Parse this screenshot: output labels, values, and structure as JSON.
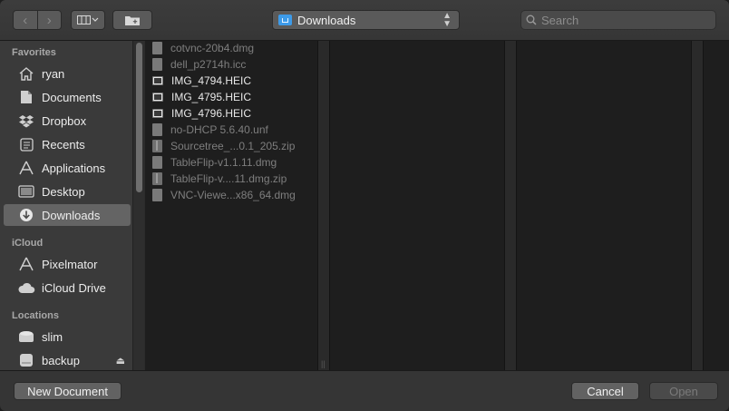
{
  "toolbar": {
    "location": "Downloads",
    "search_placeholder": "Search"
  },
  "sidebar": {
    "favorites_header": "Favorites",
    "favorites": [
      {
        "label": "ryan",
        "icon": "home-icon"
      },
      {
        "label": "Documents",
        "icon": "documents-icon"
      },
      {
        "label": "Dropbox",
        "icon": "dropbox-icon"
      },
      {
        "label": "Recents",
        "icon": "recents-icon"
      },
      {
        "label": "Applications",
        "icon": "applications-icon"
      },
      {
        "label": "Desktop",
        "icon": "desktop-icon"
      },
      {
        "label": "Downloads",
        "icon": "downloads-icon",
        "selected": true
      }
    ],
    "icloud_header": "iCloud",
    "icloud": [
      {
        "label": "Pixelmator",
        "icon": "pixelmator-icon"
      },
      {
        "label": "iCloud Drive",
        "icon": "cloud-icon"
      }
    ],
    "locations_header": "Locations",
    "locations": [
      {
        "label": "slim",
        "icon": "network-icon"
      },
      {
        "label": "backup",
        "icon": "disk-icon",
        "eject": true
      }
    ]
  },
  "files": [
    {
      "name": "cotvnc-20b4.dmg",
      "enabled": false,
      "icon": "file-icon"
    },
    {
      "name": "dell_p2714h.icc",
      "enabled": false,
      "icon": "file-icon"
    },
    {
      "name": "IMG_4794.HEIC",
      "enabled": true,
      "icon": "image-icon"
    },
    {
      "name": "IMG_4795.HEIC",
      "enabled": true,
      "icon": "image-icon"
    },
    {
      "name": "IMG_4796.HEIC",
      "enabled": true,
      "icon": "image-icon"
    },
    {
      "name": "no-DHCP 5.6.40.unf",
      "enabled": false,
      "icon": "file-icon"
    },
    {
      "name": "Sourcetree_...0.1_205.zip",
      "enabled": false,
      "icon": "zip-icon"
    },
    {
      "name": "TableFlip-v1.1.11.dmg",
      "enabled": false,
      "icon": "file-icon"
    },
    {
      "name": "TableFlip-v....11.dmg.zip",
      "enabled": false,
      "icon": "zip-icon"
    },
    {
      "name": "VNC-Viewe...x86_64.dmg",
      "enabled": false,
      "icon": "file-icon"
    }
  ],
  "buttons": {
    "new_document": "New Document",
    "cancel": "Cancel",
    "open": "Open"
  }
}
